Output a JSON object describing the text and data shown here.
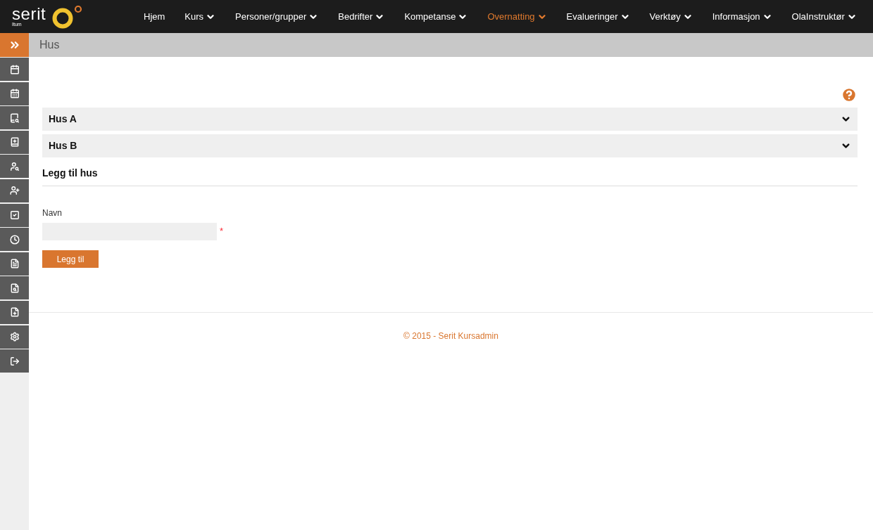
{
  "logo": {
    "wordmark": "serit",
    "subtitle": "Itum"
  },
  "nav": [
    {
      "label": "Hjem",
      "dropdown": false,
      "selected": false
    },
    {
      "label": "Kurs",
      "dropdown": true,
      "selected": false
    },
    {
      "label": "Personer/grupper",
      "dropdown": true,
      "selected": false
    },
    {
      "label": "Bedrifter",
      "dropdown": true,
      "selected": false
    },
    {
      "label": "Kompetanse",
      "dropdown": true,
      "selected": false
    },
    {
      "label": "Overnatting",
      "dropdown": true,
      "selected": true
    },
    {
      "label": "Evalueringer",
      "dropdown": true,
      "selected": false
    },
    {
      "label": "Verktøy",
      "dropdown": true,
      "selected": false
    },
    {
      "label": "Informasjon",
      "dropdown": true,
      "selected": false
    },
    {
      "label": "OlaInstruktør",
      "dropdown": true,
      "selected": false
    }
  ],
  "page_title": "Hus",
  "houses": [
    {
      "name": "Hus A",
      "expanded": false
    },
    {
      "name": "Hus B",
      "expanded": false
    }
  ],
  "add_section": {
    "heading": "Legg til hus",
    "field_label": "Navn",
    "required_mark": "*",
    "button": "Legg til"
  },
  "footer": "© 2015 - Serit Kursadmin"
}
